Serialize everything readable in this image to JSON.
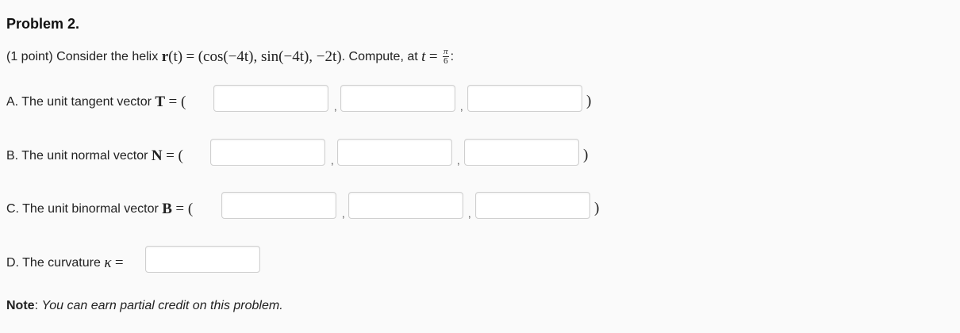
{
  "problem": {
    "title": "Problem 2.",
    "points": "(1 point)",
    "intro": "Consider the helix",
    "r_symbol": "r",
    "r_arg": "(t)",
    "equals": "=",
    "helix_expr": "(cos(−4t), sin(−4t), −2t)",
    "compute_text": ". Compute, at",
    "t_var": "t",
    "t_frac_num": "π",
    "t_frac_den": "6",
    "colon": ":"
  },
  "parts": {
    "A": {
      "label": "A. The unit tangent vector",
      "symbol": "T",
      "eq": "= (",
      "close": ")",
      "sep": ",",
      "values": [
        "",
        "",
        ""
      ]
    },
    "B": {
      "label": "B. The unit normal vector",
      "symbol": "N",
      "eq": "= (",
      "close": ")",
      "sep": ",",
      "values": [
        "",
        "",
        ""
      ]
    },
    "C": {
      "label": "C. The unit binormal vector",
      "symbol": "B",
      "eq": "= (",
      "close": ")",
      "sep": ",",
      "values": [
        "",
        "",
        ""
      ]
    },
    "D": {
      "label": "D. The curvature",
      "symbol": "κ",
      "eq": "=",
      "value": ""
    }
  },
  "note": {
    "label": "Note",
    "colon": ":",
    "text": "You can earn partial credit on this problem."
  }
}
